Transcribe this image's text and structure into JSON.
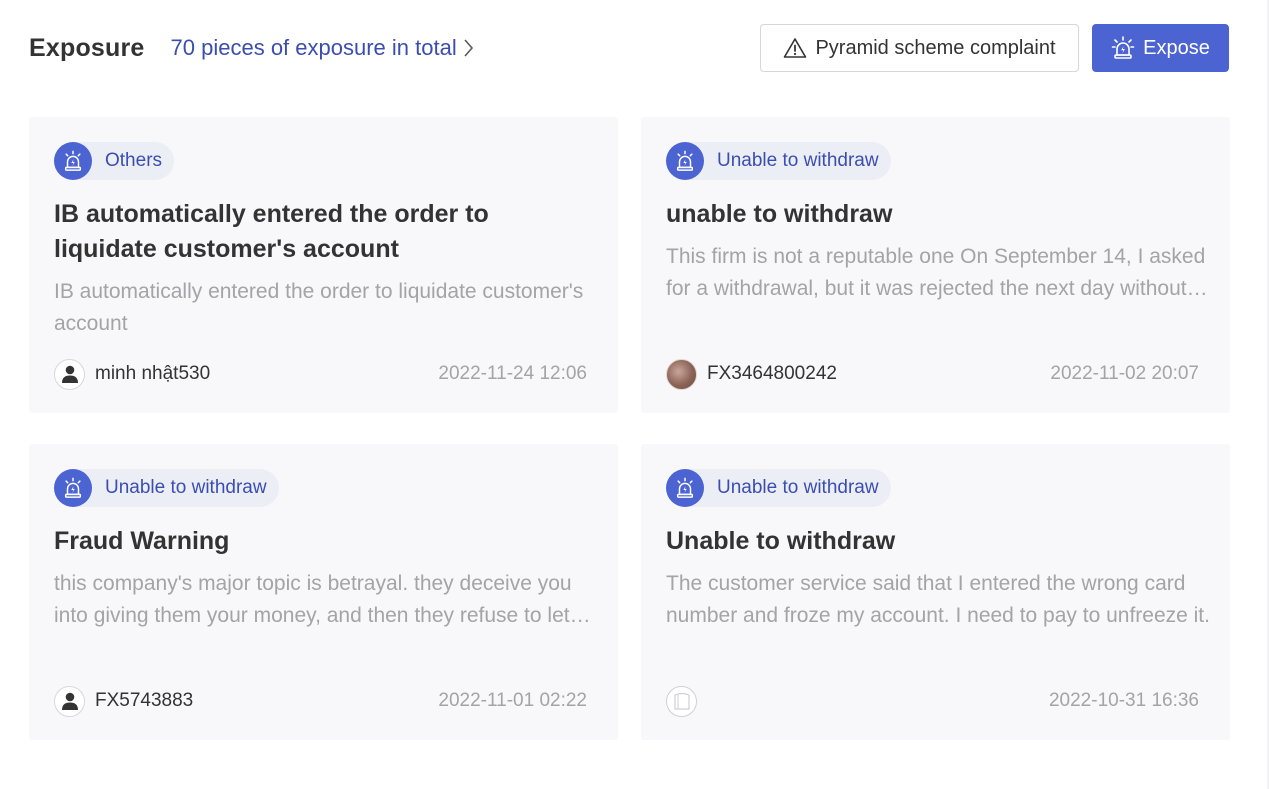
{
  "header": {
    "title": "Exposure",
    "total_link": "70 pieces of exposure in total",
    "complaint_button": "Pyramid scheme complaint",
    "expose_button": "Expose"
  },
  "colors": {
    "accent": "#4c63d2",
    "link": "#3b4eb0",
    "card_bg": "#f8f8fa",
    "muted_text": "#a3a3a8"
  },
  "cards": [
    {
      "tag": "Others",
      "title": "IB automatically entered the order to liquidate customer's account",
      "description": "IB automatically entered the order to liquidate customer's account",
      "username": "minh nhật530",
      "avatar": "default-user-icon",
      "date": "2022-11-24 12:06"
    },
    {
      "tag": "Unable to withdraw",
      "title": "unable to withdraw",
      "description": "This firm is not a reputable one On September 14, I asked for a withdrawal, but it was rejected the next day without any explanation.",
      "username": "FX3464800242",
      "avatar": "photo",
      "date": "2022-11-02 20:07"
    },
    {
      "tag": "Unable to withdraw",
      "title": "Fraud Warning",
      "description": "this company's major topic is betrayal. they deceive you into giving them your money, and then they refuse to let you withdraw.",
      "username": "FX5743883",
      "avatar": "default-user-icon",
      "date": "2022-11-01 02:22"
    },
    {
      "tag": "Unable to withdraw",
      "title": "Unable to withdraw",
      "description": "The customer service said that I entered the wrong card number and froze my account. I need to pay to unfreeze it.",
      "username": "",
      "avatar": "blank",
      "date": "2022-10-31 16:36"
    }
  ]
}
